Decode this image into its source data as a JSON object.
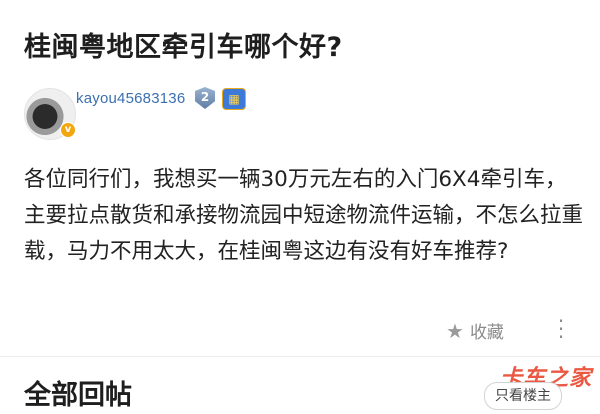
{
  "post": {
    "title": "桂闽粤地区牵引车哪个好?",
    "author": {
      "username": "kayou45683136",
      "level": "2",
      "verified_mark": "v"
    },
    "content": "各位同行们，我想买一辆30万元左右的入门6X4牵引车，主要拉点散货和承接物流园中短途物流件运输，不怎么拉重载，马力不用太大，在桂闽粤这边有没有好车推荐?",
    "actions": {
      "favorite_label": "收藏",
      "favorite_icon": "star-icon",
      "more_icon": "more-dots-icon"
    }
  },
  "replies": {
    "section_title": "全部回帖",
    "only_owner_label": "只看楼主"
  },
  "watermark": "卡车之家",
  "colors": {
    "username": "#3b6fb0",
    "watermark": "#e8462d",
    "muted": "#8a8a8a"
  }
}
